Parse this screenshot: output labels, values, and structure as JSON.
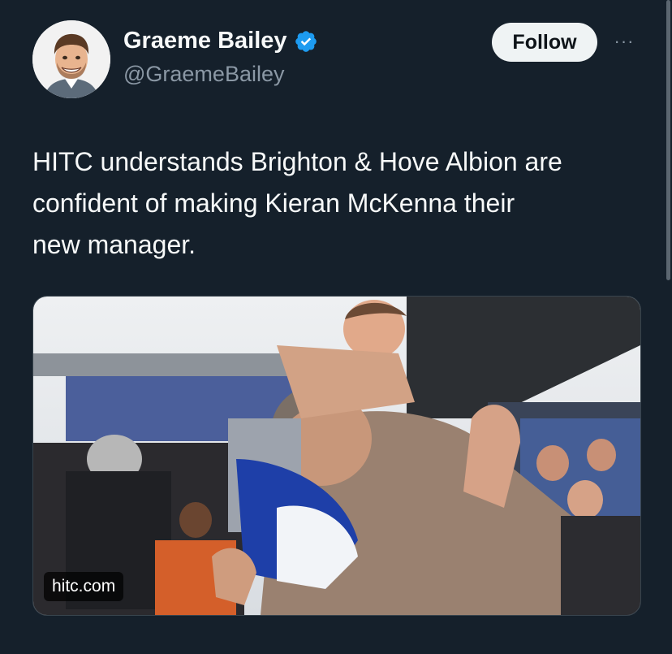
{
  "author": {
    "name": "Graeme Bailey",
    "handle": "@GraemeBailey",
    "verified": true,
    "verified_color": "#1d9bf0"
  },
  "actions": {
    "follow_label": "Follow",
    "more_label": "···"
  },
  "tweet": {
    "text": "HITC understands Brighton & Hove Albion are\nconfident of making Kieran McKenna their\nnew manager."
  },
  "media": {
    "source_label": "hitc.com"
  },
  "colors": {
    "background": "#15202b",
    "text_primary": "#f7f9f9",
    "text_secondary": "#8b98a5",
    "button_bg": "#eff3f4"
  }
}
